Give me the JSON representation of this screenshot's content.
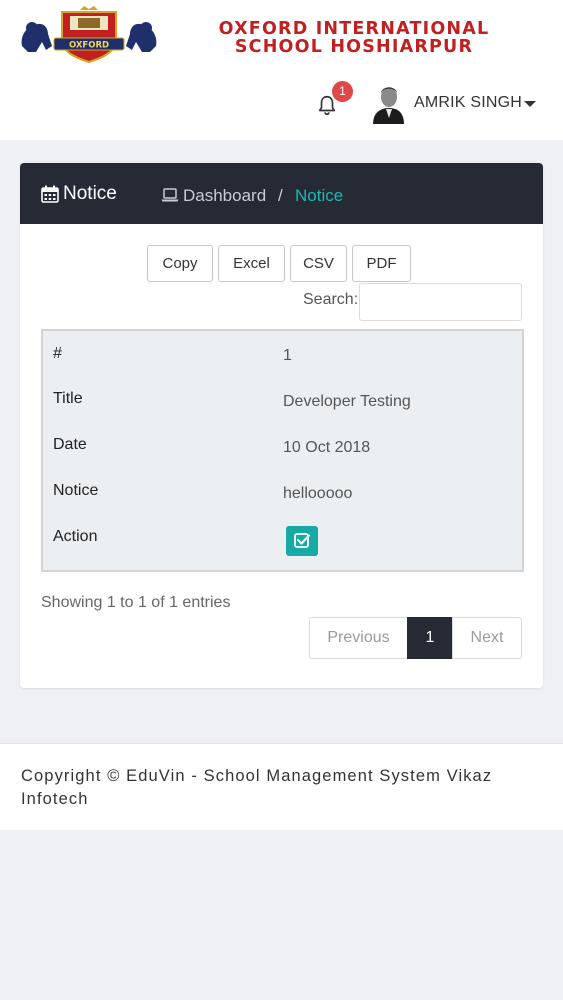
{
  "header": {
    "school_name_line1": "OXFORD INTERNATIONAL",
    "school_name_line2": "SCHOOL HOSHIARPUR",
    "logo_text": "OXFORD",
    "notification_count": "1",
    "user_name": "AMRIK SINGH"
  },
  "panel": {
    "title": "Notice",
    "breadcrumb": {
      "home": "Dashboard",
      "separator": "/",
      "current": "Notice"
    },
    "export_buttons": [
      "Copy",
      "Excel",
      "CSV",
      "PDF"
    ],
    "search_label": "Search:",
    "search_value": "",
    "record": {
      "fields": [
        {
          "label": "#",
          "value": "1"
        },
        {
          "label": "Title",
          "value": "Developer Testing"
        },
        {
          "label": "Date",
          "value": "10 Oct 2018"
        },
        {
          "label": "Notice",
          "value": "hellooooo"
        },
        {
          "label": "Action",
          "value": ""
        }
      ]
    },
    "showing_text": "Showing 1 to 1 of 1 entries",
    "pagination": {
      "previous": "Previous",
      "current": "1",
      "next": "Next"
    }
  },
  "footer": {
    "copyright": "Copyright © EduVin - School Management System Vikaz Infotech"
  },
  "colors": {
    "brand_red": "#c0201f",
    "header_dark": "#252a35",
    "accent_teal": "#1bb8b0",
    "badge_red": "#e04848"
  },
  "icons": {
    "notification": "bell-icon",
    "panel": "calendar-icon",
    "breadcrumb": "laptop-icon",
    "action": "check-square-icon",
    "user_menu": "caret-down-icon"
  }
}
